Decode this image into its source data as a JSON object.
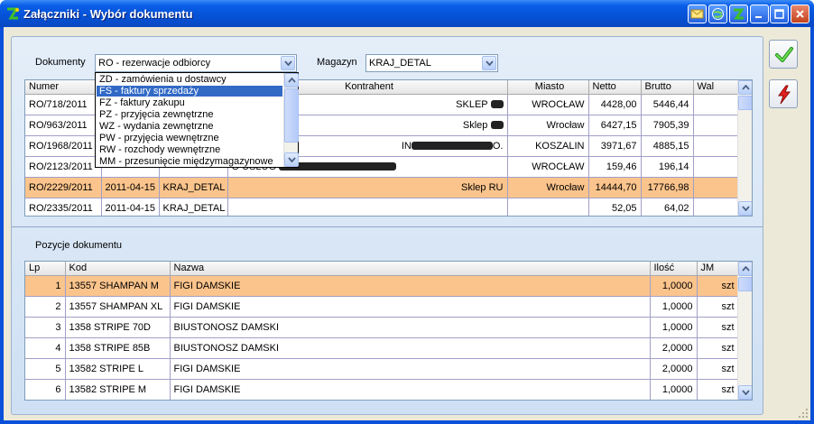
{
  "window": {
    "title": "Załączniki - Wybór dokumentu",
    "accent": "#0a50d8"
  },
  "filters": {
    "documents_label": "Dokumenty",
    "documents_value": "RO - rezerwacje odbiorcy",
    "warehouse_label": "Magazyn",
    "warehouse_value": "KRAJ_DETAL"
  },
  "document_types": [
    {
      "label": "ZD - zamówienia u dostawcy",
      "highlighted": false
    },
    {
      "label": "FS - faktury sprzedaży",
      "highlighted": true
    },
    {
      "label": "FZ - faktury zakupu",
      "highlighted": false
    },
    {
      "label": "PZ - przyjęcia zewnętrzne",
      "highlighted": false
    },
    {
      "label": "WZ - wydania zewnętrzne",
      "highlighted": false
    },
    {
      "label": "PW - przyjęcia wewnętrzne",
      "highlighted": false
    },
    {
      "label": "RW - rozchody wewnętrzne",
      "highlighted": false
    },
    {
      "label": "MM - przesunięcie międzymagazynowe",
      "highlighted": false
    }
  ],
  "documents_table": {
    "columns": [
      "Numer",
      "",
      "",
      "Kontrahent",
      "Miasto",
      "Netto",
      "Brutto",
      "Wal"
    ],
    "rows": [
      {
        "numer": "RO/718/2011",
        "data": "",
        "magazyn": "",
        "kontrahent": "SKLEP",
        "miasto": "WROCŁAW",
        "netto": "4428,00",
        "brutto": "5446,44",
        "wal": "",
        "selected": false
      },
      {
        "numer": "RO/963/2011",
        "data": "",
        "magazyn": "",
        "kontrahent": "Sklep",
        "miasto": "Wrocław",
        "netto": "6427,15",
        "brutto": "7905,39",
        "wal": "",
        "selected": false
      },
      {
        "numer": "RO/1968/2011",
        "data": "",
        "magazyn": "",
        "kontrahent": "IN",
        "miasto": "KOSZALIN",
        "netto": "3971,67",
        "brutto": "4885,15",
        "wal": "",
        "selected": false
      },
      {
        "numer": "RO/2123/2011",
        "data": "",
        "magazyn": "",
        "kontrahent": "O USŁUG",
        "miasto": "WROCŁAW",
        "netto": "159,46",
        "brutto": "196,14",
        "wal": "",
        "selected": false
      },
      {
        "numer": "RO/2229/2011",
        "data": "2011-04-15",
        "magazyn": "KRAJ_DETAL",
        "kontrahent": "Sklep RU",
        "miasto": "Wrocław",
        "netto": "14444,70",
        "brutto": "17766,98",
        "wal": "",
        "selected": true
      },
      {
        "numer": "RO/2335/2011",
        "data": "2011-04-15",
        "magazyn": "KRAJ_DETAL",
        "kontrahent": "",
        "miasto": "",
        "netto": "52,05",
        "brutto": "64,02",
        "wal": "",
        "selected": false
      }
    ]
  },
  "positions": {
    "title": "Pozycje dokumentu",
    "columns": [
      "Lp",
      "Kod",
      "Nazwa",
      "Ilość",
      "JM"
    ],
    "rows": [
      {
        "lp": "1",
        "kod": "13557 SHAMPAN M",
        "nazwa": "FIGI DAMSKIE",
        "ilosc": "1,0000",
        "jm": "szt",
        "selected": true
      },
      {
        "lp": "2",
        "kod": "13557 SHAMPAN XL",
        "nazwa": "FIGI DAMSKIE",
        "ilosc": "1,0000",
        "jm": "szt",
        "selected": false
      },
      {
        "lp": "3",
        "kod": "1358 STRIPE 70D",
        "nazwa": "BIUSTONOSZ DAMSKI",
        "ilosc": "1,0000",
        "jm": "szt",
        "selected": false
      },
      {
        "lp": "4",
        "kod": "1358 STRIPE 85B",
        "nazwa": "BIUSTONOSZ DAMSKI",
        "ilosc": "2,0000",
        "jm": "szt",
        "selected": false
      },
      {
        "lp": "5",
        "kod": "13582 STRIPE L",
        "nazwa": "FIGI DAMSKIE",
        "ilosc": "2,0000",
        "jm": "szt",
        "selected": false
      },
      {
        "lp": "6",
        "kod": "13582 STRIPE M",
        "nazwa": "FIGI DAMSKIE",
        "ilosc": "1,0000",
        "jm": "szt",
        "selected": false
      }
    ]
  },
  "icons": {
    "ok": "check-icon",
    "cancel": "lightning-icon"
  }
}
